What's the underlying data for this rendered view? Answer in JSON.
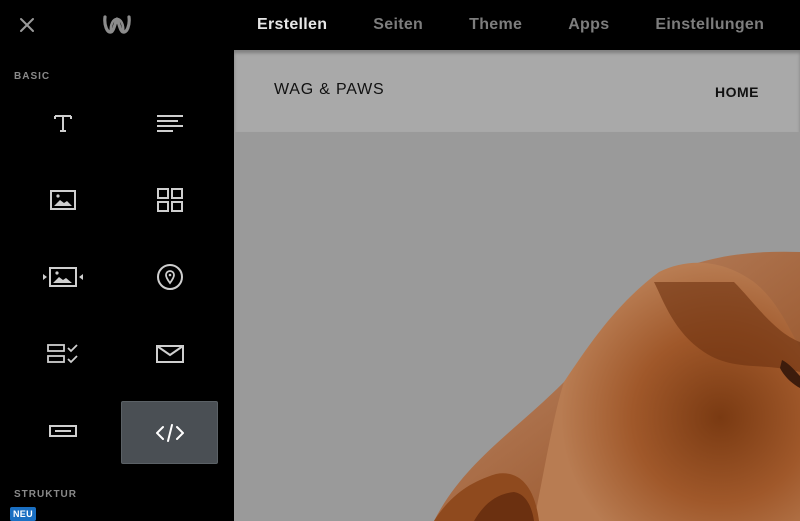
{
  "topbar": {
    "close_icon": "close-icon",
    "logo_icon": "weebly-w-logo-icon",
    "tabs": [
      {
        "label": "Erstellen",
        "active": true
      },
      {
        "label": "Seiten",
        "active": false
      },
      {
        "label": "Theme",
        "active": false
      },
      {
        "label": "Apps",
        "active": false
      },
      {
        "label": "Einstellungen",
        "active": false
      }
    ]
  },
  "sidebar": {
    "basic_label": "BASIC",
    "structure_label": "STRUKTUR",
    "new_badge": "NEU",
    "elements": [
      {
        "icon": "title-icon"
      },
      {
        "icon": "text-icon"
      },
      {
        "icon": "image-icon"
      },
      {
        "icon": "gallery-icon"
      },
      {
        "icon": "slideshow-icon"
      },
      {
        "icon": "map-icon"
      },
      {
        "icon": "contact-form-icon"
      },
      {
        "icon": "newsletter-icon"
      },
      {
        "icon": "button-icon"
      },
      {
        "icon": "embed-code-icon",
        "selected": true
      }
    ]
  },
  "preview": {
    "site_title": "WAG & PAWS",
    "nav_home": "HOME",
    "hero_image": "dog-photo"
  },
  "colors": {
    "background": "#000000",
    "preview_overlay": "#9a9a9a",
    "selected_tile": "#4a4f54",
    "badge_blue": "#1a6fc2"
  }
}
